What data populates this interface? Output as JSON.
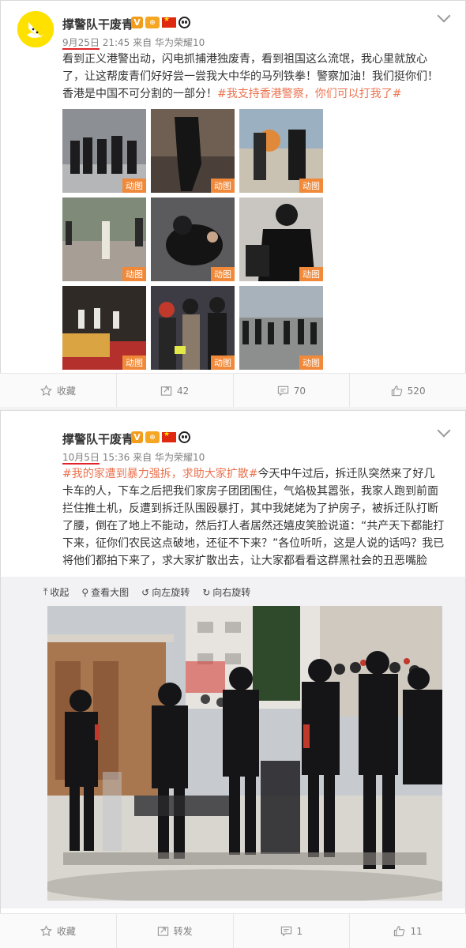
{
  "post1": {
    "username": "撑警队干废青",
    "date": "9月25日",
    "time": "21:45",
    "source": "来自 华为荣耀10",
    "body_text": "看到正义港警出动，闪电抓捕港独废青，看到祖国这么流氓，我心里就放心了，让这帮废青们好好尝一尝我大中华的马列铁拳！警察加油！我们挺你们！香港是中国不可分割的一部分！",
    "hashtag": "#我支持香港警察，你们可以打我了#",
    "gif_label": "动图",
    "actions": {
      "favorite": "收藏",
      "repost": "42",
      "comment": "70",
      "like": "520"
    }
  },
  "post2": {
    "username": "撑警队干废青",
    "date": "10月5日",
    "time": "15:36",
    "source": "来自 华为荣耀10",
    "hashtag": "#我的家遭到暴力强拆，求助大家扩散#",
    "body_text": "今天中午过后，拆迁队突然来了好几卡车的人，下车之后把我们家房子团团围住，气焰极其嚣张，我家人跑到前面拦住推土机，反遭到拆迁队围殴暴打，其中我姥姥为了护房子，被拆迁队打断了腰，倒在了地上不能动，然后打人者居然还嬉皮笑脸说道：“共产天下都能打下来，征你们农民这点破地，还征不下来？”各位听听，这是人说的话吗？我已将他们都拍下来了，求大家扩散出去，让大家都看看这群黑社会的丑恶嘴脸",
    "toolbar": {
      "collapse": "收起",
      "view_large": "查看大图",
      "rotate_left": "向左旋转",
      "rotate_right": "向右旋转"
    },
    "actions": {
      "favorite": "收藏",
      "repost": "转发",
      "comment": "1",
      "like": "11"
    }
  },
  "colors": {
    "hashtag": "#eb7350",
    "gif_badge": "#f08a3a",
    "avatar_bg": "#ffe100",
    "date_underline": "#e0242a"
  }
}
